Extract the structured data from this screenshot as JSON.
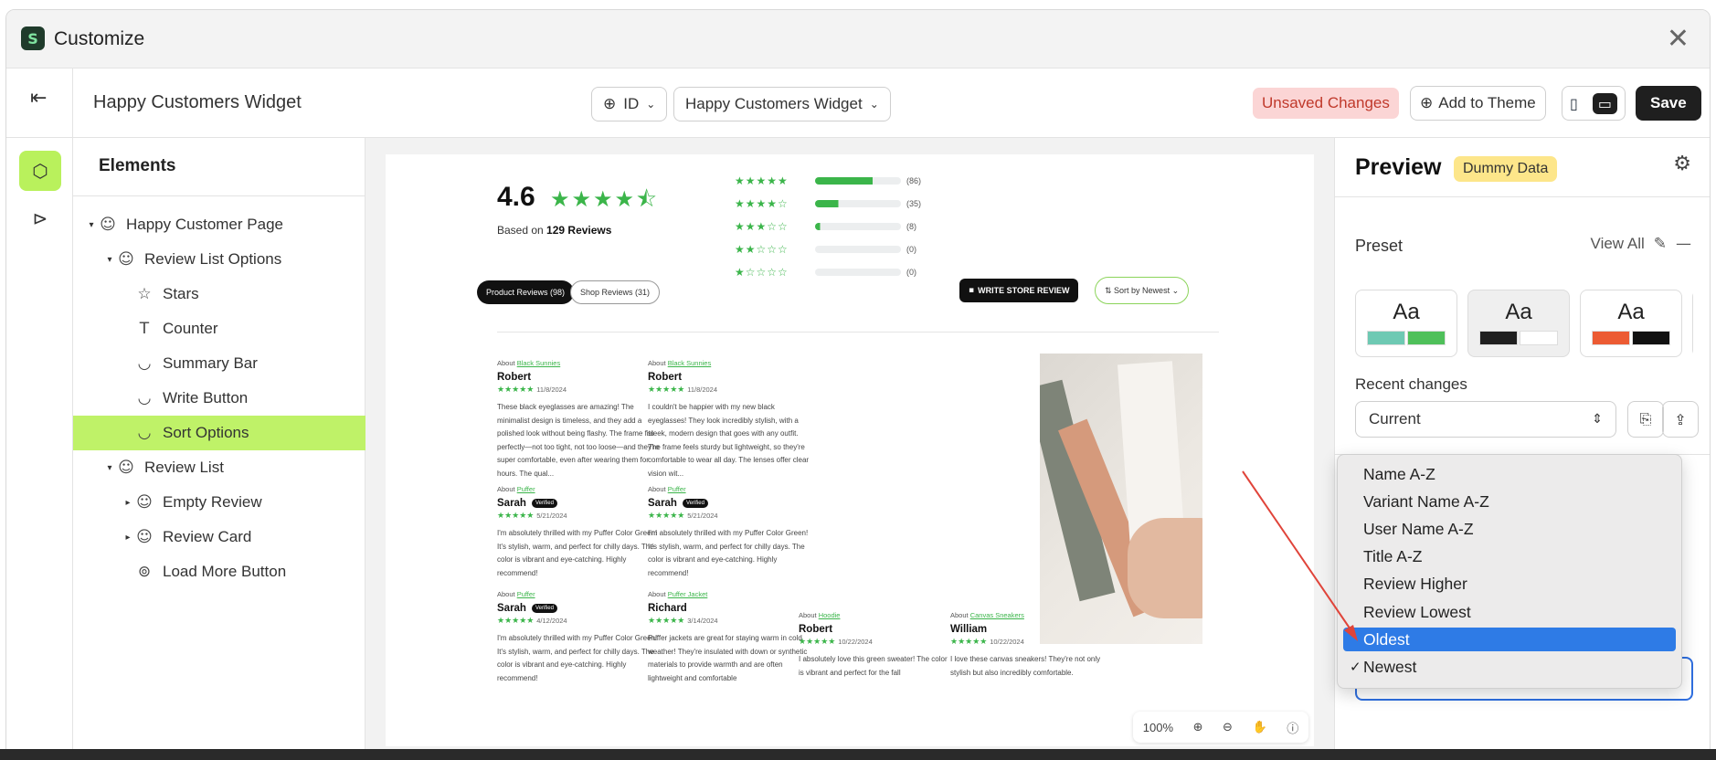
{
  "window": {
    "title": "Customize",
    "logo_letter": "S",
    "close_glyph": "✕"
  },
  "toolbar": {
    "page_name": "Happy Customers Widget",
    "language": "ID",
    "widget_select": "Happy Customers Widget",
    "unsaved": "Unsaved Changes",
    "add_to_theme": "Add to Theme",
    "save": "Save"
  },
  "elements": {
    "title": "Elements",
    "items": [
      {
        "label": "Happy Customer Page",
        "caret": "▾",
        "icon": "☺"
      },
      {
        "label": "Review List Options",
        "caret": "▾",
        "icon": "☺"
      },
      {
        "label": "Stars",
        "caret": "",
        "icon": "☆"
      },
      {
        "label": "Counter",
        "caret": "",
        "icon": "T"
      },
      {
        "label": "Summary Bar",
        "caret": "",
        "icon": "◡"
      },
      {
        "label": "Write Button",
        "caret": "",
        "icon": "◡"
      },
      {
        "label": "Sort Options",
        "caret": "",
        "icon": "◡",
        "selected": true
      },
      {
        "label": "Review List",
        "caret": "▾",
        "icon": "☺"
      },
      {
        "label": "Empty Review",
        "caret": "▸",
        "icon": "☺"
      },
      {
        "label": "Review Card",
        "caret": "▸",
        "icon": "☺"
      },
      {
        "label": "Load More Button",
        "caret": "",
        "icon": "⊚"
      }
    ]
  },
  "canvas": {
    "rating": "4.6",
    "rating_stars": "★★★★⯪",
    "based_on_prefix": "Based on ",
    "based_on_count": "129 Reviews",
    "distribution": [
      {
        "stars": "★★★★★",
        "count": "(86)",
        "fill": 0.67
      },
      {
        "stars": "★★★★☆",
        "count": "(35)",
        "fill": 0.27
      },
      {
        "stars": "★★★☆☆",
        "count": "(8)",
        "fill": 0.06
      },
      {
        "stars": "★★☆☆☆",
        "count": "(0)",
        "fill": 0
      },
      {
        "stars": "★☆☆☆☆",
        "count": "(0)",
        "fill": 0
      }
    ],
    "tab_product": "Product Reviews (98)",
    "tab_shop": "Shop Reviews (31)",
    "write_review": "WRITE STORE REVIEW",
    "sort_by": "⇅ Sort by Newest ⌄",
    "reviews": [
      {
        "about": "About ",
        "product": "Black Sunnies",
        "name": "Robert",
        "verified": "",
        "stars": "★★★★★",
        "date": "11/8/2024",
        "text": "These black eyeglasses are amazing! The minimalist design is timeless, and they add a polished look without being flashy. The frame fits perfectly—not too tight, not too loose—and they're super comfortable, even after wearing them for hours. The qual..."
      },
      {
        "about": "About ",
        "product": "Black Sunnies",
        "name": "Robert",
        "verified": "",
        "stars": "★★★★★",
        "date": "11/8/2024",
        "text": "I couldn't be happier with my new black eyeglasses! They look incredibly stylish, with a sleek, modern design that goes with any outfit. The frame feels sturdy but lightweight, so they're comfortable to wear all day. The lenses offer clear vision wit..."
      },
      {
        "about": "About ",
        "product": "Puffer",
        "name": "Sarah",
        "verified": "Verified",
        "stars": "★★★★★",
        "date": "5/21/2024",
        "text": "I'm absolutely thrilled with my Puffer Color Green! It's stylish, warm, and perfect for chilly days. The color is vibrant and eye-catching. Highly recommend!"
      },
      {
        "about": "About ",
        "product": "Puffer",
        "name": "Sarah",
        "verified": "Verified",
        "stars": "★★★★★",
        "date": "5/21/2024",
        "text": "I'm absolutely thrilled with my Puffer Color Green! It's stylish, warm, and perfect for chilly days. The color is vibrant and eye-catching. Highly recommend!"
      },
      {
        "about": "About ",
        "product": "Puffer",
        "name": "Sarah",
        "verified": "Verified",
        "stars": "★★★★★",
        "date": "4/12/2024",
        "text": "I'm absolutely thrilled with my Puffer Color Green! It's stylish, warm, and perfect for chilly days. The color is vibrant and eye-catching. Highly recommend!"
      },
      {
        "about": "About ",
        "product": "Puffer Jacket",
        "name": "Richard",
        "verified": "",
        "stars": "★★★★★",
        "date": "3/14/2024",
        "text": "Puffer jackets are great for staying warm in cold weather! They're insulated with down or synthetic materials to provide warmth and are often lightweight and comfortable"
      },
      {
        "about": "About ",
        "product": "Hoodie",
        "name": "Robert",
        "verified": "",
        "stars": "★★★★★",
        "date": "10/22/2024",
        "text": "I absolutely love this green sweater! The color is vibrant and perfect for the fall"
      },
      {
        "about": "About ",
        "product": "Canvas Sneakers",
        "name": "William",
        "verified": "",
        "stars": "★★★★★",
        "date": "10/22/2024",
        "text": "I love these canvas sneakers! They're not only stylish but also incredibly comfortable."
      }
    ],
    "zoom": "100%"
  },
  "right_panel": {
    "title": "Preview",
    "badge": "Dummy Data",
    "preset_label": "Preset",
    "view_all": "View All",
    "presets": [
      {
        "label": "Aa",
        "c1": "#6ec9b3",
        "c2": "#4fc05a"
      },
      {
        "label": "Aa",
        "c1": "#1f1f1f",
        "c2": "#ffffff"
      },
      {
        "label": "Aa",
        "c1": "#ec5b33",
        "c2": "#111111"
      }
    ],
    "recent_label": "Recent changes",
    "recent_value": "Current"
  },
  "sort_dropdown": {
    "options": [
      "Name A-Z",
      "Variant Name A-Z",
      "User Name A-Z",
      "Title A-Z",
      "Review Higher",
      "Review Lowest",
      "Oldest",
      "Newest"
    ],
    "highlighted": "Oldest",
    "checked": "Newest",
    "check_glyph": "✓"
  },
  "colors": {
    "accent_green": "#bff268",
    "star_green": "#3bb54a",
    "highlight_blue": "#2e7be6",
    "annotation_red": "#e0443a"
  }
}
